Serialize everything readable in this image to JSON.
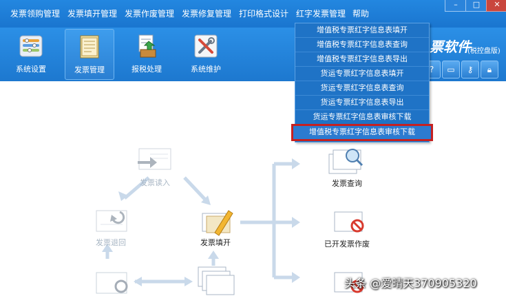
{
  "menubar": {
    "items": [
      "发票领购管理",
      "发票填开管理",
      "发票作废管理",
      "发票修复管理",
      "打印格式设计",
      "红字发票管理",
      "帮助"
    ]
  },
  "window": {
    "min_label": "–",
    "max_label": "□",
    "close_label": "✕"
  },
  "toolbar": {
    "buttons": [
      {
        "label": "系统设置"
      },
      {
        "label": "发票管理"
      },
      {
        "label": "报税处理"
      },
      {
        "label": "系统维护"
      }
    ]
  },
  "brand": {
    "title": "票软件",
    "subtitle": "(税控盘版)"
  },
  "dropdown": {
    "items": [
      "增值税专票红字信息表填开",
      "增值税专票红字信息表查询",
      "增值税专票红字信息表导出",
      "货运专票红字信息表填开",
      "货运专票红字信息表查询",
      "货运专票红字信息表导出",
      "货运专票红字信息表审核下载",
      "增值税专票红字信息表审核下载"
    ]
  },
  "flow": {
    "nodes": {
      "read": "发票读入",
      "return": "发票退回",
      "fill": "发票填开",
      "query": "发票查询",
      "void": "已开发票作废"
    }
  },
  "watermark": "头条 @爱晴天370905320"
}
